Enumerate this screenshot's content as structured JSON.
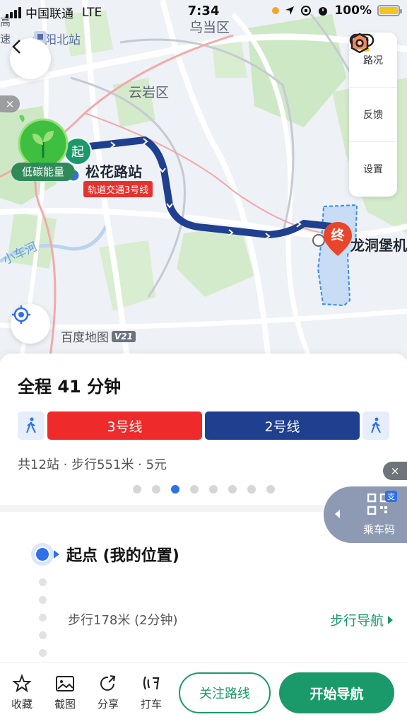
{
  "status_bar": {
    "carrier": "中国联通",
    "network": "LTE",
    "time": "7:34",
    "battery": "100%",
    "battery_level": 1.0
  },
  "map": {
    "labels": {
      "wudang": "乌当区",
      "yunyan": "云岩区",
      "guiyang_north": "贵阳北站",
      "xiaochehe": "小车河",
      "edge_left": "高",
      "edge_left2": "速"
    },
    "start_marker": "起",
    "end_marker": "终",
    "start_station": "松花路站",
    "start_line_tag": "轨道交通3号线",
    "destination": "龙洞堡机场",
    "eco_label": "低碳能量",
    "logo_text": "百度地图",
    "logo_version": "V21",
    "close_icon": "×",
    "right_panel": {
      "traffic": "路况",
      "feedback": "反馈",
      "settings": "设置"
    },
    "colors": {
      "route": "#1f3f8f",
      "start": "#1a9a6a",
      "end": "#e8452c"
    }
  },
  "route_sheet": {
    "total_time": "全程 41 分钟",
    "segments": [
      {
        "type": "walk"
      },
      {
        "type": "line",
        "label": "3号线",
        "color": "#ef2a2a"
      },
      {
        "type": "line",
        "label": "2号线",
        "color": "#1f3f8f"
      },
      {
        "type": "walk"
      }
    ],
    "summary": "共12站 · 步行551米 · 5元",
    "page_count": 8,
    "active_page": 3,
    "start_title": "起点 (我的位置)",
    "walk_text": "步行178米 (2分钟)",
    "walk_nav": "步行导航"
  },
  "ride_code": {
    "label": "乘车码",
    "badge": "支",
    "close": "×"
  },
  "bottom_bar": {
    "favorite": "收藏",
    "screenshot": "截图",
    "share": "分享",
    "taxi": "打车",
    "follow_route": "关注路线",
    "start_nav": "开始导航"
  }
}
